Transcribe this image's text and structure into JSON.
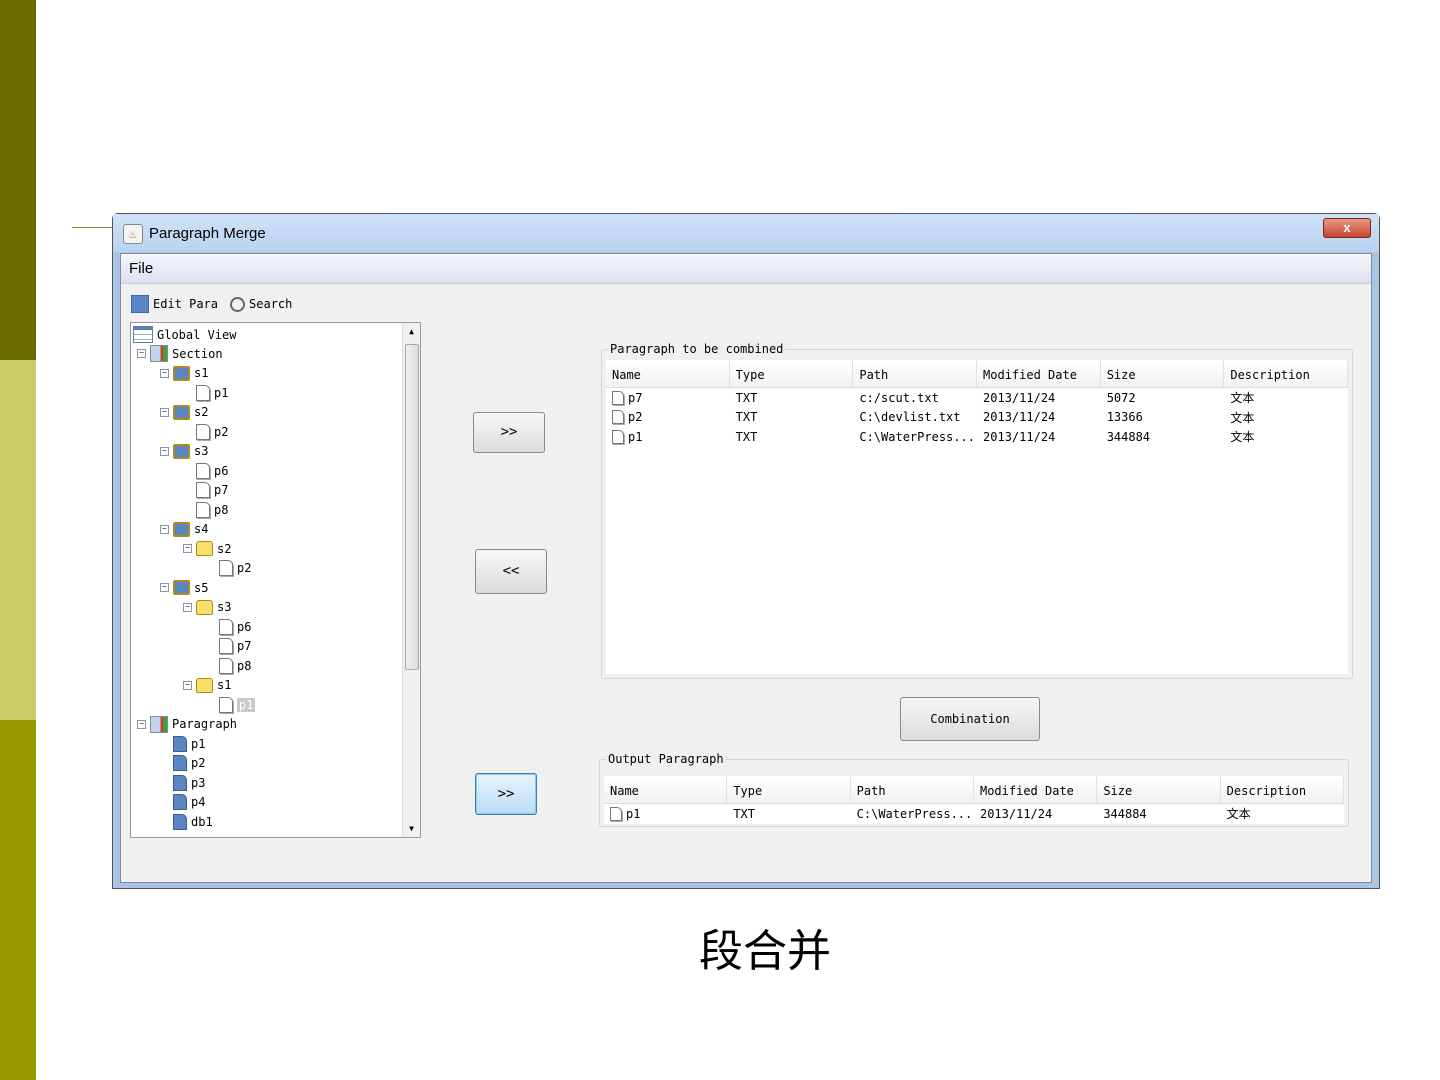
{
  "window": {
    "title": "Paragraph Merge",
    "close": "x"
  },
  "menu": {
    "file": "File"
  },
  "toolbar": {
    "edit_para": "Edit Para",
    "search": "Search"
  },
  "tree": {
    "root": "Global View",
    "nodes": [
      {
        "label": "Section",
        "depth": 1,
        "icon": "section",
        "exp": true
      },
      {
        "label": "s1",
        "depth": 2,
        "icon": "bfolder",
        "exp": true
      },
      {
        "label": "p1",
        "depth": 3,
        "icon": "page"
      },
      {
        "label": "s2",
        "depth": 2,
        "icon": "bfolder",
        "exp": true
      },
      {
        "label": "p2",
        "depth": 3,
        "icon": "page"
      },
      {
        "label": "s3",
        "depth": 2,
        "icon": "bfolder",
        "exp": true
      },
      {
        "label": "p6",
        "depth": 3,
        "icon": "page"
      },
      {
        "label": "p7",
        "depth": 3,
        "icon": "page"
      },
      {
        "label": "p8",
        "depth": 3,
        "icon": "page"
      },
      {
        "label": "s4",
        "depth": 2,
        "icon": "bfolder",
        "exp": true
      },
      {
        "label": "s2",
        "depth": 3,
        "icon": "yfolder",
        "exp": true
      },
      {
        "label": "p2",
        "depth": 4,
        "icon": "page"
      },
      {
        "label": "s5",
        "depth": 2,
        "icon": "bfolder",
        "exp": true
      },
      {
        "label": "s3",
        "depth": 3,
        "icon": "yfolder",
        "exp": true
      },
      {
        "label": "p6",
        "depth": 4,
        "icon": "page"
      },
      {
        "label": "p7",
        "depth": 4,
        "icon": "page"
      },
      {
        "label": "p8",
        "depth": 4,
        "icon": "page"
      },
      {
        "label": "s1",
        "depth": 3,
        "icon": "yfolder",
        "exp": true
      },
      {
        "label": "p1",
        "depth": 4,
        "icon": "page",
        "selected": true
      },
      {
        "label": "Paragraph",
        "depth": 1,
        "icon": "section",
        "exp": true
      },
      {
        "label": "p1",
        "depth": 2,
        "icon": "bpage"
      },
      {
        "label": "p2",
        "depth": 2,
        "icon": "bpage"
      },
      {
        "label": "p3",
        "depth": 2,
        "icon": "bpage"
      },
      {
        "label": "p4",
        "depth": 2,
        "icon": "bpage"
      },
      {
        "label": "db1",
        "depth": 2,
        "icon": "bpage"
      }
    ]
  },
  "buttons": {
    "add": ">>",
    "remove": "<<",
    "output": ">>",
    "combination": "Combination"
  },
  "combined": {
    "label": "Paragraph to be combined",
    "columns": [
      "Name",
      "Type",
      "Path",
      "Modified Date",
      "Size",
      "Description"
    ],
    "rows": [
      [
        "p7",
        "TXT",
        "c:/scut.txt",
        "2013/11/24",
        "5072",
        "文本"
      ],
      [
        "p2",
        "TXT",
        "C:\\devlist.txt",
        "2013/11/24",
        "13366",
        "文本"
      ],
      [
        "p1",
        "TXT",
        "C:\\WaterPress...",
        "2013/11/24",
        "344884",
        "文本"
      ]
    ]
  },
  "output": {
    "label": "Output Paragraph",
    "columns": [
      "Name",
      "Type",
      "Path",
      "Modified Date",
      "Size",
      "Description"
    ],
    "rows": [
      [
        "p1",
        "TXT",
        "C:\\WaterPress...",
        "2013/11/24",
        "344884",
        "文本"
      ]
    ]
  },
  "caption": "段合并"
}
